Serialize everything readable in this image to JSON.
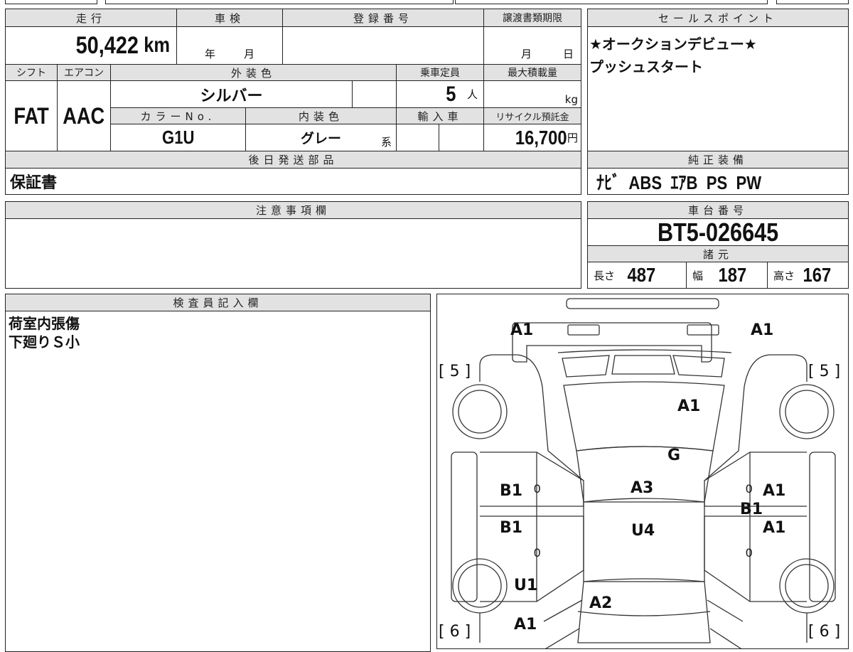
{
  "top": {
    "mileage_h": "走行",
    "mileage": "50,422",
    "mileage_unit": "km",
    "inspection_h": "車検",
    "year": "年",
    "month": "月",
    "reg_h": "登録番号",
    "transfer_h": "譲渡書類期限",
    "t_month": "月",
    "t_day": "日"
  },
  "row2": {
    "shift_h": "シフト",
    "ac_h": "エアコン",
    "ext_h": "外装色",
    "seats_h": "乗車定員",
    "load_h": "最大積載量",
    "shift": "FAT",
    "ac": "AAC",
    "ext": "シルバー",
    "seats": "5",
    "seats_unit": "人",
    "load_unit": "kg",
    "colorno_h": "カラーNo.",
    "int_h": "内装色",
    "import_h": "輸入車",
    "recycle_h": "リサイクル預託金",
    "colorno": "G1U",
    "int": "グレー",
    "int_suffix": "系",
    "recycle": "16,700",
    "recycle_unit": "円"
  },
  "later": {
    "h": "後日発送部品",
    "value": "保証書"
  },
  "sales": {
    "h": "セールスポイント",
    "lines": [
      "★オークションデビュー★",
      "プッシュスタート"
    ]
  },
  "equip": {
    "h": "純正装備",
    "value": "ﾅﾋﾞ  ABS  ｴｱB  PS  PW"
  },
  "notes": {
    "h": "注意事項欄"
  },
  "chassis": {
    "h": "車台番号",
    "value": "BT5-026645",
    "spec_h": "諸元",
    "len_l": "長さ",
    "len": "487",
    "wid_l": "幅",
    "wid": "187",
    "hei_l": "高さ",
    "hei": "167"
  },
  "inspector": {
    "h": "検査員記入欄",
    "lines": [
      "荷室内張傷",
      "下廻りＳ小"
    ]
  },
  "diagram": {
    "marks": [
      "A1",
      "A1",
      "[ 5 ]",
      "[ 5 ]",
      "A1",
      "G",
      "B1",
      "0",
      "A3",
      "0",
      "A1",
      "B1",
      "B1",
      "U4",
      "A1",
      "0",
      "0",
      "U1",
      "A2",
      "A1",
      "[ 6 ]",
      "[ 6 ]"
    ]
  }
}
